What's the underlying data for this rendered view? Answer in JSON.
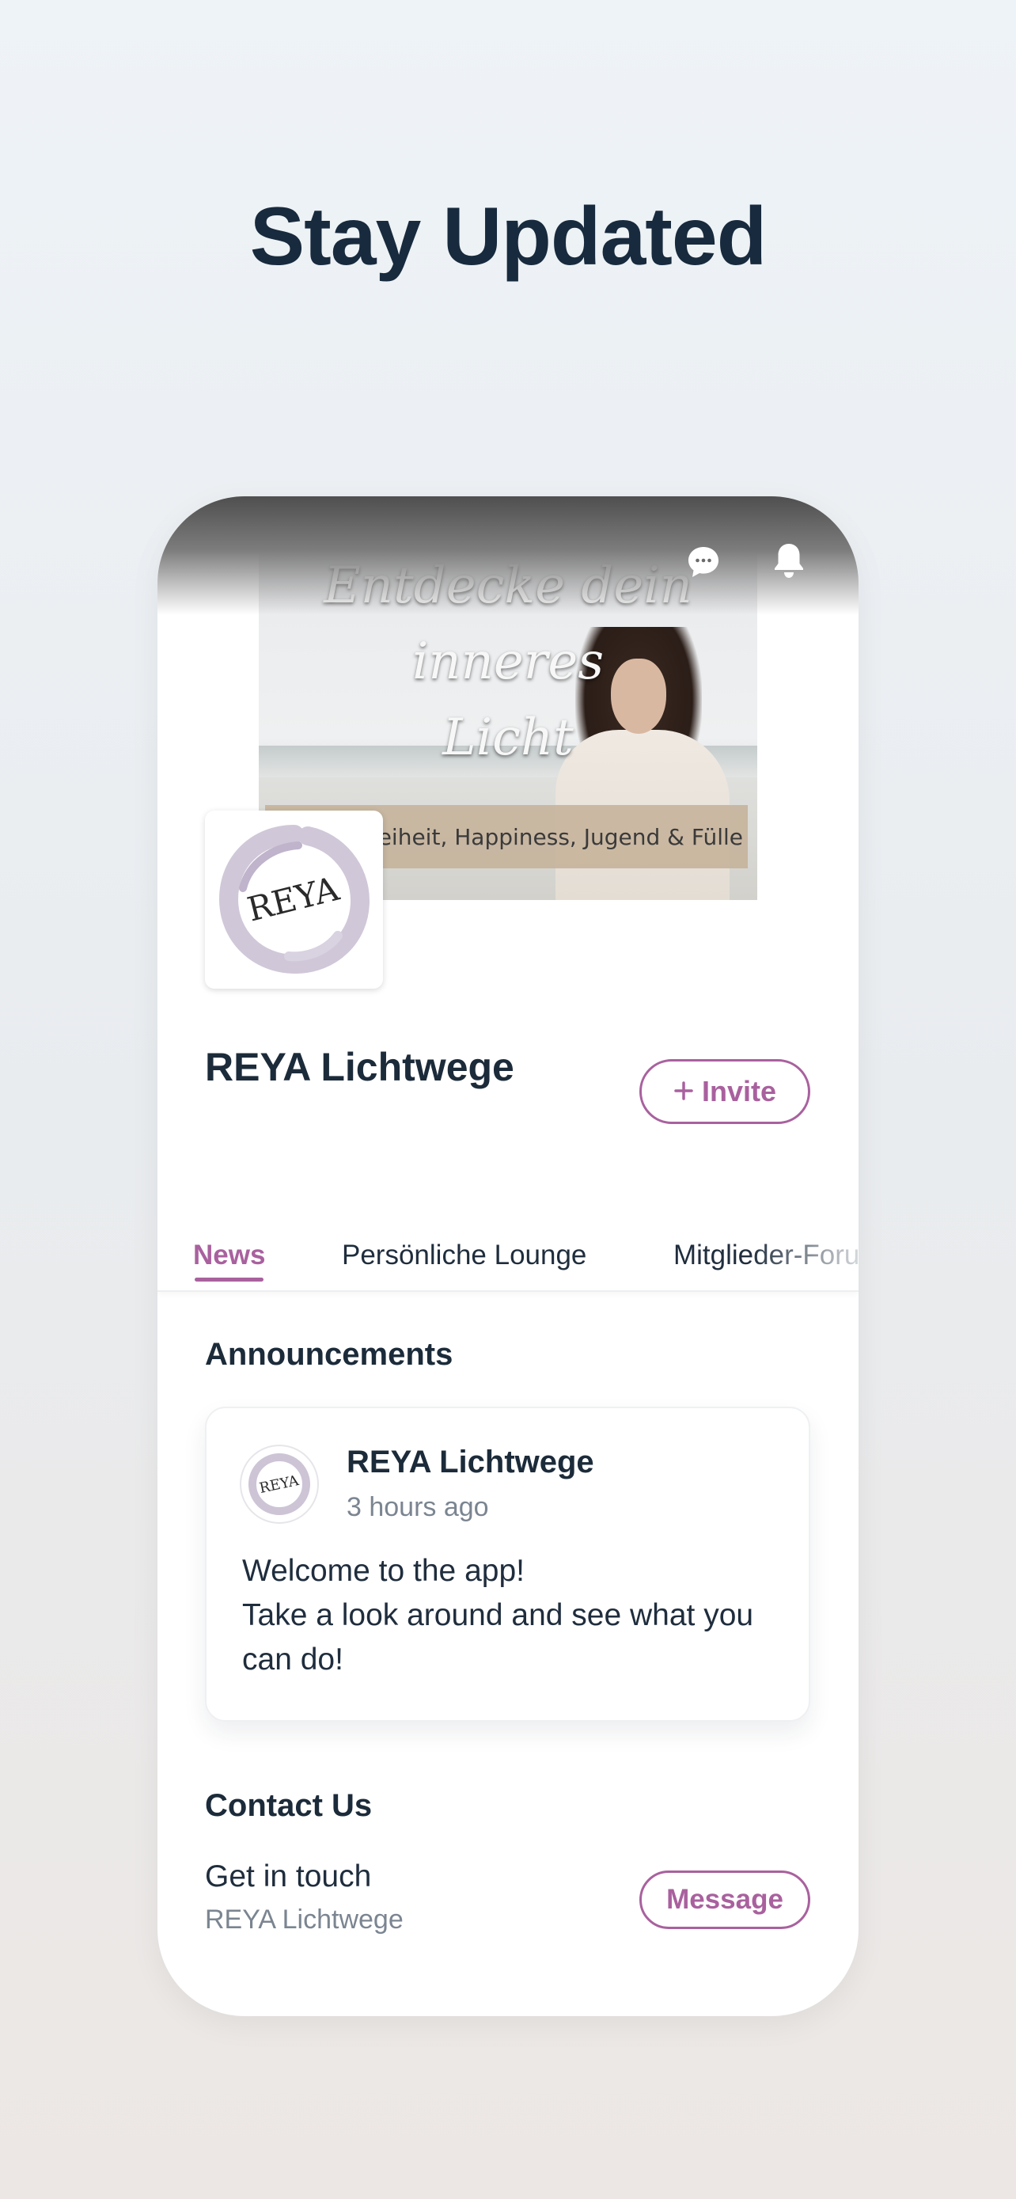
{
  "headline": "Stay Updated",
  "cover": {
    "script_line1": "Entdecke dein inneres",
    "script_line2": "Licht",
    "tagline": "u Freiheit, Happiness, Jugend & Fülle"
  },
  "logo": {
    "text": "REYA"
  },
  "brand": {
    "name": "REYA Lichtwege",
    "invite_label": "Invite"
  },
  "tabs": [
    {
      "label": "News",
      "active": true
    },
    {
      "label": "Persönliche Lounge",
      "active": false
    },
    {
      "label": "Mitglieder-Foru",
      "active": false
    }
  ],
  "announcements": {
    "title": "Announcements",
    "post": {
      "author": "REYA Lichtwege",
      "time": "3 hours ago",
      "avatar_text": "REYA",
      "body_lines": [
        "Welcome to the app!",
        "Take a look around and see what you",
        "can do!"
      ]
    }
  },
  "contact": {
    "title": "Contact Us",
    "line": "Get in touch",
    "sub": "REYA Lichtwege",
    "button_label": "Message"
  },
  "colors": {
    "accent": "#a9619e",
    "heading": "#182a3d",
    "muted": "#7b8591",
    "logo_brush": "#cdc4d6"
  },
  "icons": {
    "chat": "chat-bubble-icon",
    "bell": "bell-icon",
    "plus": "plus-icon"
  }
}
